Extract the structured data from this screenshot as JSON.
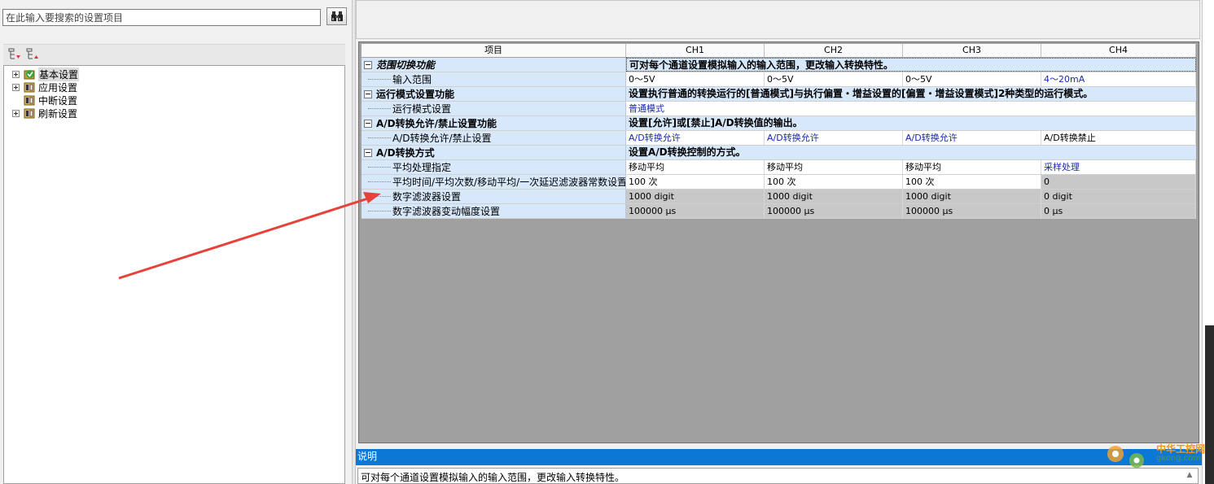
{
  "search": {
    "placeholder": "在此输入要搜索的设置项目"
  },
  "tree": {
    "items": [
      {
        "label": "基本设置"
      },
      {
        "label": "应用设置"
      },
      {
        "label": "中断设置"
      },
      {
        "label": "刷新设置"
      }
    ]
  },
  "grid": {
    "headers": {
      "item": "项目",
      "ch1": "CH1",
      "ch2": "CH2",
      "ch3": "CH3",
      "ch4": "CH4"
    },
    "rows": {
      "range_cat": {
        "label": "范围切换功能",
        "desc": "可对每个通道设置模拟输入的输入范围，更改输入转换特性。"
      },
      "input_range": {
        "label": "输入范围",
        "ch1": "0～5V",
        "ch2": "0～5V",
        "ch3": "0～5V",
        "ch4": "4～20mA"
      },
      "mode_cat": {
        "label": "运行模式设置功能",
        "desc": "设置执行普通的转换运行的[普通模式]与执行偏置・增益设置的[偏置・增益设置模式]2种类型的运行模式。"
      },
      "mode_setting": {
        "label": "运行模式设置",
        "ch1": "普通模式"
      },
      "enable_cat": {
        "label": "A/D转换允许/禁止设置功能",
        "desc": "设置[允许]或[禁止]A/D转换值的输出。"
      },
      "enable_setting": {
        "label": "A/D转换允许/禁止设置",
        "ch1": "A/D转换允许",
        "ch2": "A/D转换允许",
        "ch3": "A/D转换允许",
        "ch4": "A/D转换禁止"
      },
      "method_cat": {
        "label": "A/D转换方式",
        "desc": "设置A/D转换控制的方式。"
      },
      "avg_spec": {
        "label": "平均处理指定",
        "ch1": "移动平均",
        "ch2": "移动平均",
        "ch3": "移动平均",
        "ch4": "采样处理"
      },
      "avg_time": {
        "label": "平均时间/平均次数/移动平均/一次延迟滤波器常数设置",
        "ch1": "100 次",
        "ch2": "100 次",
        "ch3": "100 次",
        "ch4": "0"
      },
      "digital_filter": {
        "label": "数字滤波器设置",
        "ch1": "1000 digit",
        "ch2": "1000 digit",
        "ch3": "1000 digit",
        "ch4": "0 digit"
      },
      "filter_range": {
        "label": "数字滤波器变动幅度设置",
        "ch1": "100000 μs",
        "ch2": "100000 μs",
        "ch3": "100000 μs",
        "ch4": "0 μs"
      }
    }
  },
  "description": {
    "title": "说明",
    "text": "可对每个通道设置模拟输入的输入范围，更改输入转换特性。"
  },
  "watermark": {
    "text": "中华工控网",
    "url": "gkong.com"
  },
  "colors": {
    "accent_blue": "#0b78d6",
    "item_bg": "#d7e8fb",
    "arrow": "#e8413a",
    "value_blue": "#1a2ba8"
  },
  "icons": [
    "binoculars-icon",
    "expand-all-icon",
    "collapse-all-icon",
    "checked-module-icon",
    "module-icon",
    "arrow-annotation"
  ]
}
